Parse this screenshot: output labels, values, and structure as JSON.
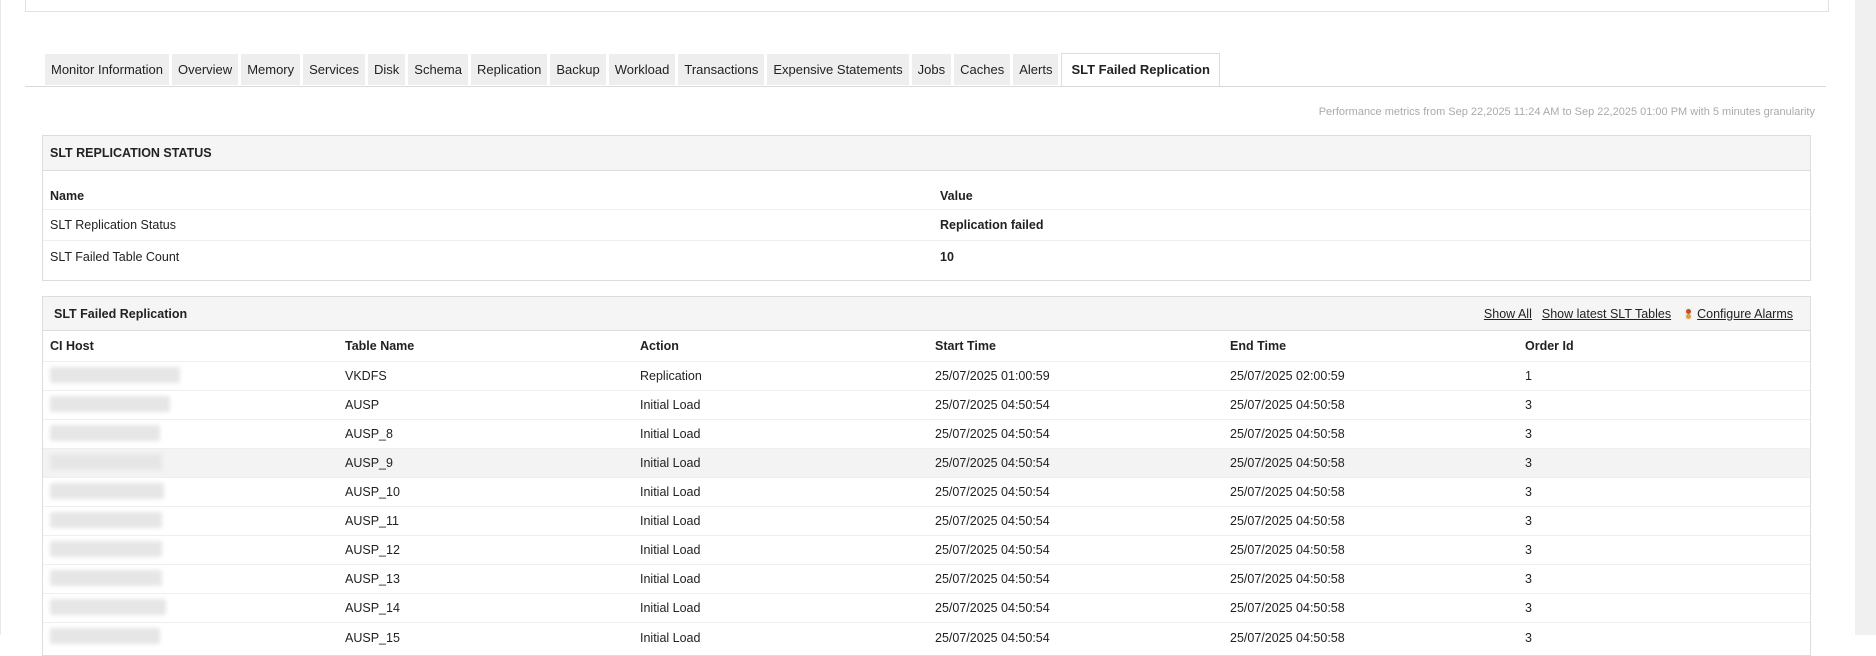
{
  "tabs": [
    "Monitor Information",
    "Overview",
    "Memory",
    "Services",
    "Disk",
    "Schema",
    "Replication",
    "Backup",
    "Workload",
    "Transactions",
    "Expensive Statements",
    "Jobs",
    "Caches",
    "Alerts",
    "SLT Failed Replication"
  ],
  "active_tab": "SLT Failed Replication",
  "perf_text": "Performance metrics from Sep 22,2025 11:24 AM to Sep 22,2025 01:00 PM with 5 minutes granularity",
  "status": {
    "title": "SLT REPLICATION STATUS",
    "headers": [
      "Name",
      "Value"
    ],
    "rows": [
      [
        "SLT Replication Status",
        "Replication failed"
      ],
      [
        "SLT Failed Table Count",
        "10"
      ]
    ]
  },
  "failed": {
    "title": "SLT Failed Replication",
    "links": {
      "show_all": "Show All",
      "show_latest": "Show latest SLT Tables",
      "configure": "Configure Alarms"
    },
    "headers": [
      "CI Host",
      "Table Name",
      "Action",
      "Start Time",
      "End Time",
      "Order Id"
    ],
    "rows": [
      [
        "VKDFS",
        "Replication",
        "25/07/2025 01:00:59",
        "25/07/2025 02:00:59",
        "1"
      ],
      [
        "AUSP",
        "Initial Load",
        "25/07/2025 04:50:54",
        "25/07/2025 04:50:58",
        "3"
      ],
      [
        "AUSP_8",
        "Initial Load",
        "25/07/2025 04:50:54",
        "25/07/2025 04:50:58",
        "3"
      ],
      [
        "AUSP_9",
        "Initial Load",
        "25/07/2025 04:50:54",
        "25/07/2025 04:50:58",
        "3"
      ],
      [
        "AUSP_10",
        "Initial Load",
        "25/07/2025 04:50:54",
        "25/07/2025 04:50:58",
        "3"
      ],
      [
        "AUSP_11",
        "Initial Load",
        "25/07/2025 04:50:54",
        "25/07/2025 04:50:58",
        "3"
      ],
      [
        "AUSP_12",
        "Initial Load",
        "25/07/2025 04:50:54",
        "25/07/2025 04:50:58",
        "3"
      ],
      [
        "AUSP_13",
        "Initial Load",
        "25/07/2025 04:50:54",
        "25/07/2025 04:50:58",
        "3"
      ],
      [
        "AUSP_14",
        "Initial Load",
        "25/07/2025 04:50:54",
        "25/07/2025 04:50:58",
        "3"
      ],
      [
        "AUSP_15",
        "Initial Load",
        "25/07/2025 04:50:54",
        "25/07/2025 04:50:58",
        "3"
      ]
    ]
  }
}
